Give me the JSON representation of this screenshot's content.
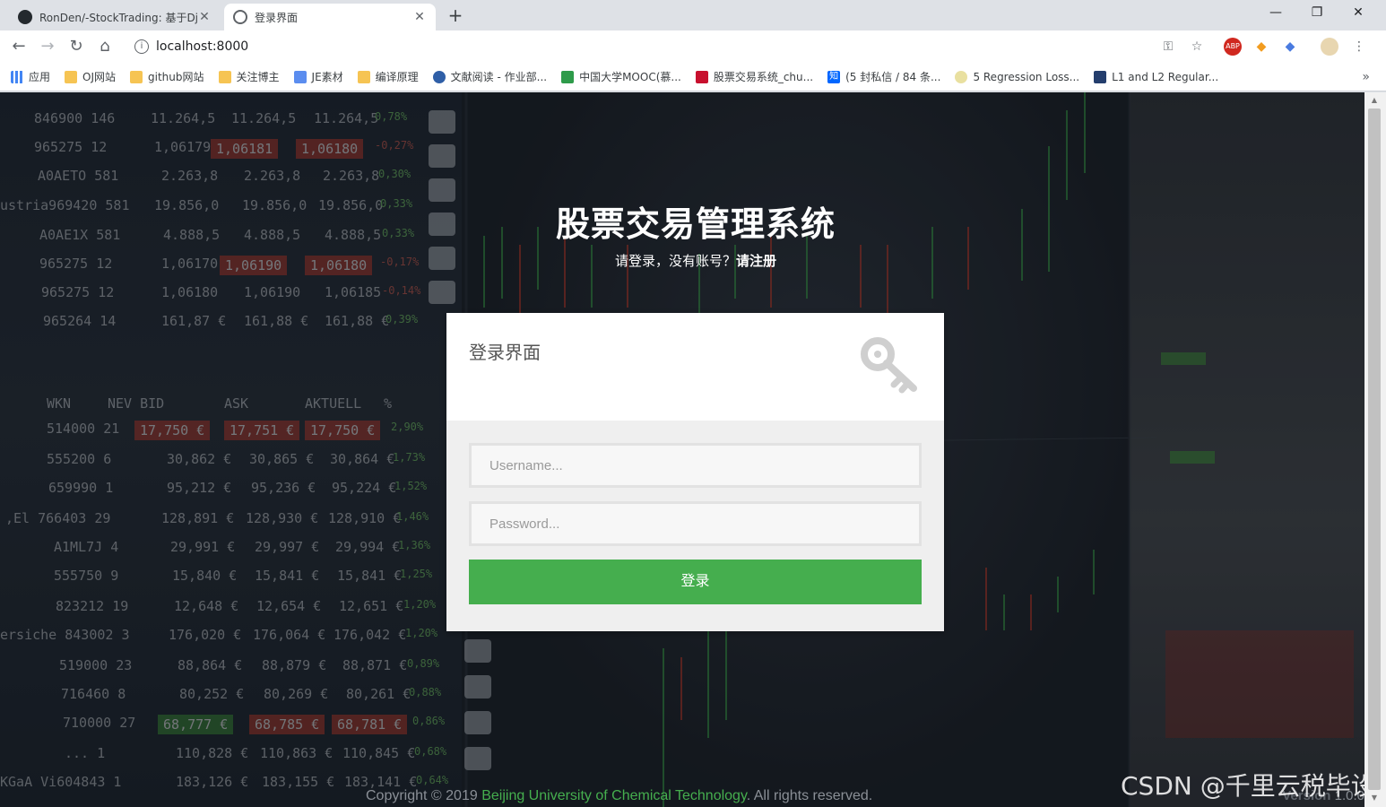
{
  "browser": {
    "tabs": [
      {
        "title": "RonDen/-StockTrading: 基于Dj",
        "icon": "github-icon",
        "active": false
      },
      {
        "title": "登录界面",
        "icon": "globe-icon",
        "active": true
      }
    ],
    "new_tab": "+",
    "window_controls": {
      "minimize": "—",
      "restore": "❐",
      "close": "✕"
    },
    "url": "localhost:8000",
    "bookmarks": [
      {
        "label": "应用",
        "icon": "apps-grid-icon"
      },
      {
        "label": "OJ网站",
        "icon": "folder-icon"
      },
      {
        "label": "github网站",
        "icon": "folder-icon"
      },
      {
        "label": "关注博主",
        "icon": "folder-icon"
      },
      {
        "label": "JE素材",
        "icon": "je-icon"
      },
      {
        "label": "编译原理",
        "icon": "folder-icon"
      },
      {
        "label": "文献阅读 - 作业部...",
        "icon": "circle-icon"
      },
      {
        "label": "中国大学MOOC(慕...",
        "icon": "flag-icon"
      },
      {
        "label": "股票交易系统_chu...",
        "icon": "csdn-icon"
      },
      {
        "label": "(5 封私信 / 84 条...",
        "icon": "zhihu-icon"
      },
      {
        "label": "5 Regression Loss...",
        "icon": "shield-icon"
      },
      {
        "label": "L1 and L2 Regular...",
        "icon": "page-icon"
      }
    ],
    "bookmarks_more": "»"
  },
  "page": {
    "title": "股票交易管理系统",
    "subtitle_prefix": "请登录，没有账号？",
    "register_link": "请注册",
    "login_card": {
      "title": "登录界面",
      "username_placeholder": "Username...",
      "password_placeholder": "Password...",
      "submit_label": "登录"
    },
    "footer": {
      "copyright": "Copyright © 2019",
      "org": "Beijing University of Chemical Technology",
      "rights": ". All rights reserved.",
      "version_label": "Version",
      "version_value": "1.0.0"
    },
    "watermark": "CSDN @千里云税毕设"
  },
  "colors": {
    "accent_green": "#45ae4e",
    "tab_bar": "#dee1e6"
  }
}
